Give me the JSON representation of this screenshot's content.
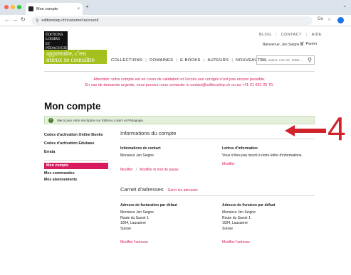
{
  "browser": {
    "tab_title": "Mon compte",
    "tab_close": "×",
    "new_tab": "+",
    "url": "editionslep.ch/customer/account/",
    "zoom": "Go",
    "dot_colors": [
      "#ff5f57",
      "#febc2e",
      "#28c840"
    ]
  },
  "header": {
    "top_links": [
      "BLOG",
      "CONTACT",
      "AIDE"
    ],
    "welcome": "Bienvenue, Jen Seigne",
    "cart": "Panier",
    "logo_black_lines": [
      "ÉDITIONS",
      "LOISIRS",
      "ET PÉDAGOGIE"
    ],
    "logo_lime_lines": [
      "apprendre, c'est",
      "mieux se connaître"
    ],
    "nav": [
      "COLLECTIONS",
      "DOMAINES",
      "E-BOOKS",
      "AUTEURS",
      "NOUVEAUTÉS"
    ],
    "search_placeholder": "Titre, auteur, mot-clé, ISBN..."
  },
  "alert": {
    "line1": "Attention: votre compte est en cours de validation et l'accès aux corrigés n'est pas encore possible.",
    "line2": "En cas de demande urgente, vous pouvez nous contacter à contact@editionslep.ch ou au +41 21 651 25 70."
  },
  "page": {
    "title": "Mon compte",
    "notice": "Merci pour votre inscription sur Editions Loisirs et Pédagogie."
  },
  "sidebar": {
    "group1": [
      "Codes d'activation Online Books",
      "Codes d'activation Edubase",
      "Errata"
    ],
    "group2": [
      "Mon compte",
      "Mes commandes",
      "Mes abonnements"
    ]
  },
  "account_info": {
    "title": "Informations du compte",
    "contact_heading": "Informations de contact",
    "contact_name": "Monsieur Jen Seigne",
    "edit_link": "Modifier",
    "password_link": "Modifier le mot de passe",
    "newsletter_heading": "Lettres d'information",
    "newsletter_text": "Vous n'êtes pas inscrit à notre lettre d'informations.",
    "newsletter_edit": "Modifier"
  },
  "address_book": {
    "title": "Carnet d'adresses",
    "manage_link": "Gérer les adresses",
    "billing_heading": "Adresse de facturation par défaut",
    "shipping_heading": "Adresse de livraison par défaut",
    "billing_lines": [
      "Monsieur Jen Seigne",
      "Route du Savoir 1",
      "1004, Lausanne",
      "Suisse"
    ],
    "shipping_lines": [
      "Monsieur Jen Seigne",
      "Route du Savoir 1",
      "1004, Lausanne",
      "Suisse"
    ],
    "edit_address": "Modifier l'adresse"
  },
  "annotation": {
    "number": "4",
    "color": "#d0232a"
  },
  "colors": {
    "accent": "#d81b60",
    "brand_lime": "#a2c11c",
    "notice_bg": "#e5f0dc"
  }
}
